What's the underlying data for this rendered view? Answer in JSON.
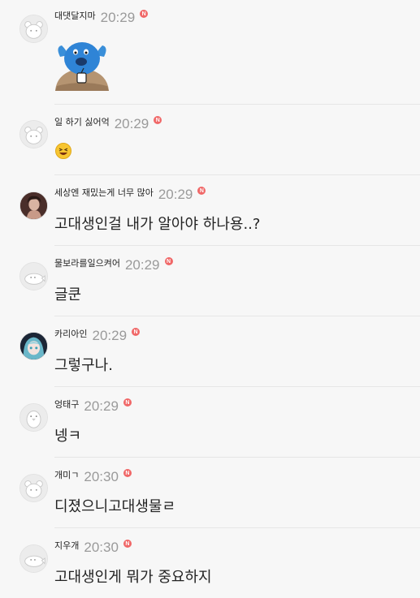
{
  "comments": [
    {
      "nickname": "대댓달지마",
      "time": "20:29",
      "badge": "N",
      "content_type": "sticker",
      "text": ""
    },
    {
      "nickname": "일 하기 싫어억",
      "time": "20:29",
      "badge": "N",
      "content_type": "emoji",
      "text": ""
    },
    {
      "nickname": "세상엔 재밌는게 너무 많아",
      "time": "20:29",
      "badge": "N",
      "content_type": "text",
      "text": "고대생인걸 내가 알아야 하나용..?"
    },
    {
      "nickname": "물보라를일으켜어",
      "time": "20:29",
      "badge": "N",
      "content_type": "text",
      "text": "글쿤"
    },
    {
      "nickname": "카리아인",
      "time": "20:29",
      "badge": "N",
      "content_type": "text",
      "text": "그렇구나."
    },
    {
      "nickname": "엉태구",
      "time": "20:29",
      "badge": "N",
      "content_type": "text",
      "text": "넹ㅋ"
    },
    {
      "nickname": "개미ㄱ",
      "time": "20:30",
      "badge": "N",
      "content_type": "text",
      "text": "디졌으니고대생물ㄹ"
    },
    {
      "nickname": "지우개",
      "time": "20:30",
      "badge": "N",
      "content_type": "text",
      "text": "고대생인게 뭐가 중요하지"
    }
  ],
  "colors": {
    "badge": "#f06767",
    "time": "#9a9a9a",
    "background": "#f7f7f7",
    "divider": "#e6e6e6"
  },
  "icons": [
    "bear-avatar-icon",
    "photo-avatar-icon",
    "seal-avatar-icon",
    "anime-avatar-icon",
    "penguin-avatar-icon",
    "blue-character-sticker",
    "laughing-emoji-icon"
  ]
}
